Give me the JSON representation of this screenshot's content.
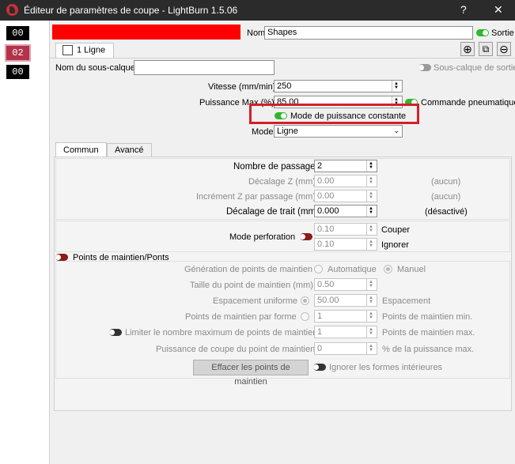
{
  "window": {
    "title": "Éditeur de paramètres de coupe - LightBurn 1.5.06",
    "help_label": "?",
    "close_label": "✕"
  },
  "layers": [
    {
      "label": "00"
    },
    {
      "label": "02"
    },
    {
      "label": "00"
    }
  ],
  "header": {
    "color": "#ff0000",
    "name_label": "Nom",
    "name_value": "Shapes",
    "output_label": "Sortie"
  },
  "sublayer_tab": {
    "label": "1 Ligne"
  },
  "toolbar": {
    "add_icon": "⊕",
    "copy_icon": "⧉",
    "remove_icon": "⊖"
  },
  "sublayer": {
    "name_label": "Nom du sous-calque",
    "name_value": "",
    "output_label": "Sous-calque de sortie"
  },
  "params": {
    "speed_label": "Vitesse (mm/min)",
    "speed_value": "250",
    "power_max_label": "Puissance Max (%)",
    "power_max_value": "85,00",
    "air_assist_label": "Commande pneumatique",
    "constant_power_label": "Mode de puissance constante",
    "mode_label": "Mode",
    "mode_value": "Ligne"
  },
  "tabs": {
    "common": "Commun",
    "advanced": "Avancé"
  },
  "common": {
    "passes_label": "Nombre de passages",
    "passes_value": "2",
    "z_offset_label": "Décalage Z (mm)",
    "z_offset_value": "0.00",
    "z_offset_note": "(aucun)",
    "z_step_label": "Incrément Z par passage (mm)",
    "z_step_value": "0.00",
    "z_step_note": "(aucun)",
    "kerf_label": "Décalage de trait (mm)",
    "kerf_value": "0.000",
    "kerf_note": "(désactivé)",
    "perf_label": "Mode perforation",
    "perf_cut_value": "0.10",
    "perf_cut_label": "Couper",
    "perf_skip_value": "0.10",
    "perf_skip_label": "Ignorer"
  },
  "tabs_section": {
    "title": "Points de maintien/Ponts",
    "generation_label": "Génération de points de maintien",
    "auto_label": "Automatique",
    "manual_label": "Manuel",
    "size_label": "Taille du point de maintien (mm)",
    "size_value": "0.50",
    "uniform_label": "Espacement uniforme",
    "spacing_value": "50.00",
    "spacing_label": "Espacement",
    "per_shape_label": "Points de maintien par forme",
    "min_value": "1",
    "min_label": "Points de maintien min.",
    "limit_label": "Limiter le nombre maximum de points de maintien",
    "max_value": "1",
    "max_label": "Points de maintien max.",
    "power_label": "Puissance de coupe du point de maintien",
    "power_value": "0",
    "power_unit": "% de la puissance max.",
    "clear_button": "Effacer les points de maintien",
    "ignore_inner_label": "Ignorer les formes intérieures"
  }
}
